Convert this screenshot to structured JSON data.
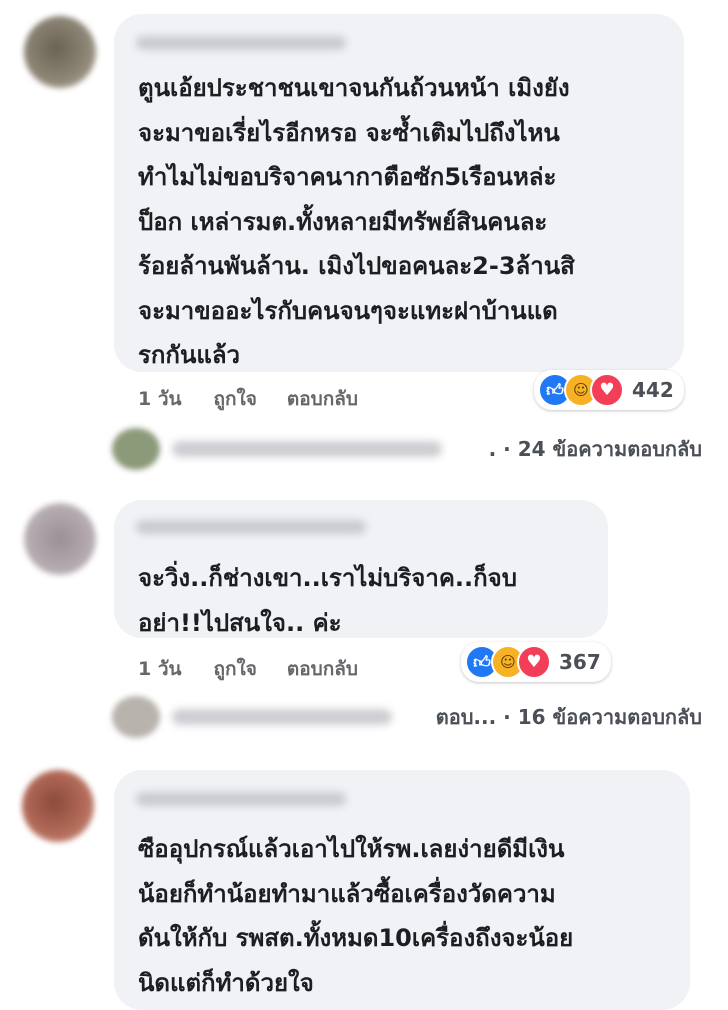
{
  "comments": [
    {
      "text": "ตูนเอ้ยประชาชนเขาจนกันถ้วนหน้า เมิงยัง\nจะมาขอเรี่ยไรอีกหรอ จะซ้ำเติมไปถึงไหน\nทำไมไม่ขอบริจาคนากาตือซัก5เรือนหล่ะ\nป็อก เหล่ารมต.ทั้งหลายมีทรัพย์สินคนละ\nร้อยล้านพันล้าน. เมิงไปขอคนละ2-3ล้านสิ\nจะมาขออะไรกับคนจนๆจะแทะฝาบ้านแด\nรกกันแล้ว",
      "time": "1 วัน",
      "like_label": "ถูกใจ",
      "reply_label": "ตอบกลับ",
      "reaction_icons": [
        "like-icon",
        "haha-icon",
        "love-icon"
      ],
      "reaction_count": "442",
      "replies_text": ". · 24 ข้อความตอบกลับ"
    },
    {
      "text": "จะวิ่ง..ก็ช่างเขา..เราไม่บริจาค..ก็จบ\nอย่า!!ไปสนใจ.. ค่ะ",
      "time": "1 วัน",
      "like_label": "ถูกใจ",
      "reply_label": "ตอบกลับ",
      "reaction_icons": [
        "like-icon",
        "haha-icon",
        "love-icon"
      ],
      "reaction_count": "367",
      "replies_prefix": "ตอบ...",
      "replies_text": "· 16 ข้อความตอบกลับ"
    },
    {
      "text": "ซืออุปกรณ์แล้วเอาไปให้รพ.เลยง่ายดีมีเงิน\nน้อยก็ทำน้อยทำมาแล้วซื้อเครื่องวัดความ\nดันให้กับ รพสต.ทั้งหมด10เครื่องถึงจะน้อย\nนิดแต่ก็ทำด้วยใจ"
    }
  ],
  "colors": {
    "bubble": "#f0f2f5",
    "text": "#1c1e21",
    "meta": "#65676b",
    "like": "#2078f4",
    "haha": "#f7b125",
    "love": "#f33e58"
  }
}
